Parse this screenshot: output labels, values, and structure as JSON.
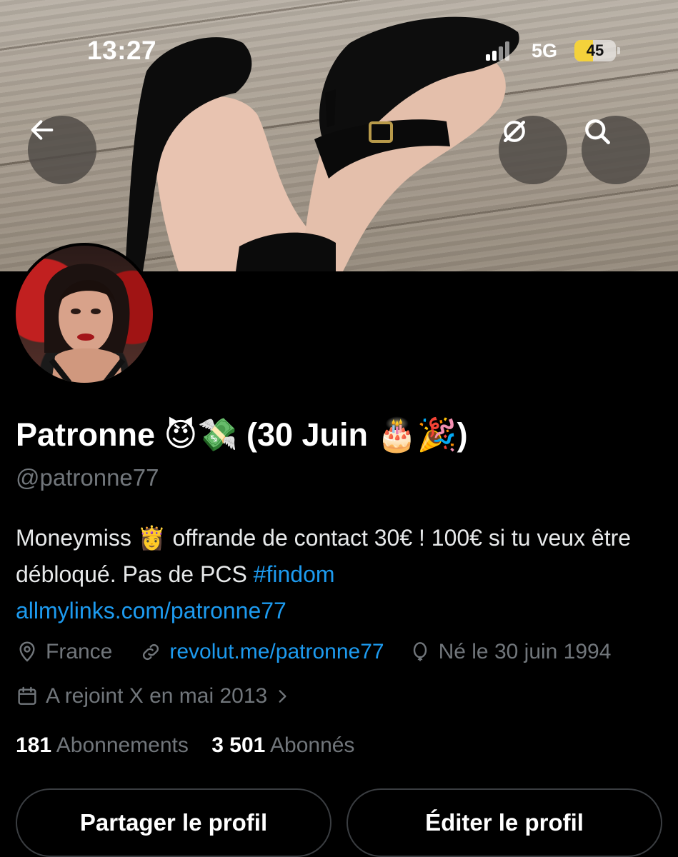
{
  "status_bar": {
    "time": "13:27",
    "network": "5G",
    "battery_level": "45",
    "battery_color": "#f4d23b"
  },
  "header_icons": {
    "back": "arrow-left-icon",
    "grok": "grok-icon",
    "search": "search-icon"
  },
  "profile": {
    "display_name": "Patronne 😈💸 (30 Juin 🎂🎉)",
    "handle": "@patronne77",
    "bio_text_1": "Moneymiss 👸 offrande de contact 30€ ! 100€ si tu veux être débloqué. Pas de PCS ",
    "bio_hashtag": "#findom",
    "bio_link": "allmylinks.com/patronne77",
    "location": "France",
    "website": "revolut.me/patronne77",
    "birthday": "Né le 30 juin 1994",
    "joined": "A rejoint X en mai 2013",
    "following_count": "181",
    "following_label": "Abonnements",
    "followers_count": "3 501",
    "followers_label": "Abonnés"
  },
  "buttons": {
    "share": "Partager le profil",
    "edit": "Éditer le profil"
  },
  "colors": {
    "accent": "#1d9bf0",
    "secondary_text": "#71767b",
    "background": "#000000"
  }
}
